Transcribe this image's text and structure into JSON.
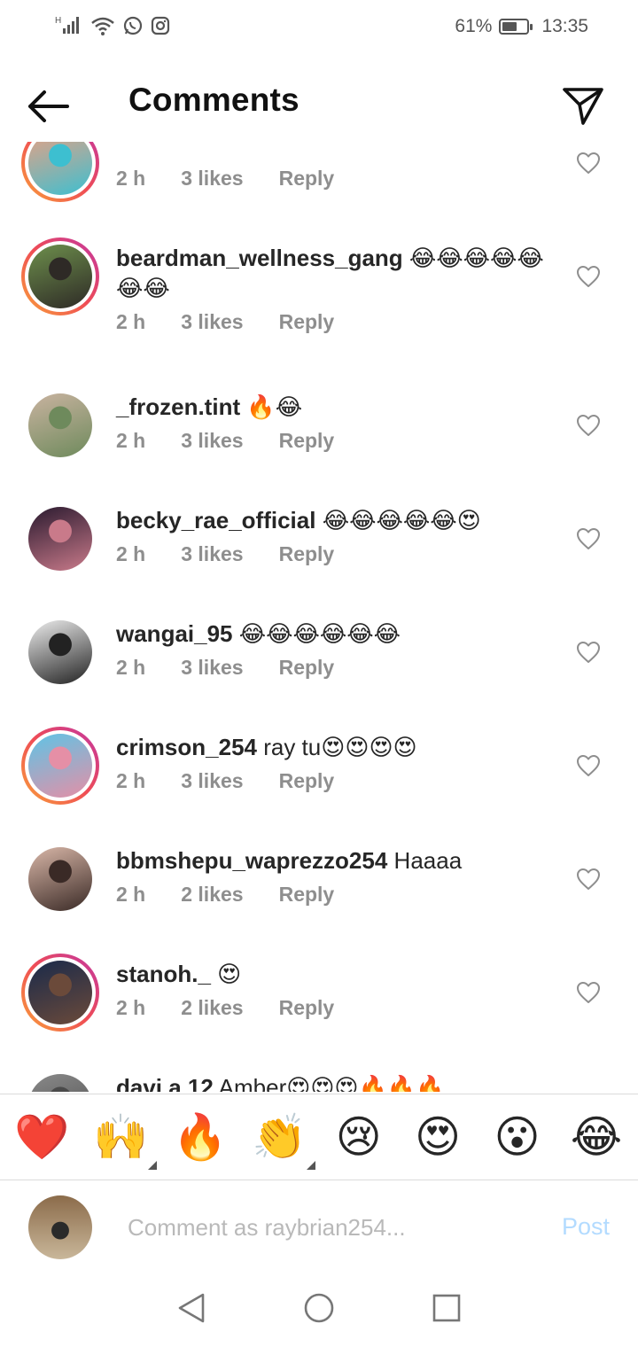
{
  "status_bar": {
    "battery_text": "61%",
    "battery_level": 0.61,
    "time": "13:35"
  },
  "header": {
    "title": "Comments"
  },
  "comments": [
    {
      "username": "",
      "text": "",
      "time": "2 h",
      "likes": "3 likes",
      "reply": "Reply",
      "ring": "story",
      "avatar_colors": [
        "#e8a184",
        "#3dbfd0"
      ]
    },
    {
      "username": "beardman_wellness_gang",
      "text": " 😂😂😂😂😂😂😂",
      "time": "2 h",
      "likes": "3 likes",
      "reply": "Reply",
      "ring": "story",
      "avatar_colors": [
        "#6d8f4c",
        "#2e2a26"
      ]
    },
    {
      "username": "_frozen.tint",
      "text": " 🔥😂",
      "time": "2 h",
      "likes": "3 likes",
      "reply": "Reply",
      "ring": "plain",
      "avatar_colors": [
        "#c9b3a0",
        "#6e8a5c"
      ]
    },
    {
      "username": "becky_rae_official",
      "text": " 😂😂😂😂😂😍",
      "time": "2 h",
      "likes": "3 likes",
      "reply": "Reply",
      "ring": "plain",
      "avatar_colors": [
        "#2a1a2f",
        "#c97a8a"
      ]
    },
    {
      "username": "wangai_95",
      "text": " 😂😂😂😂😂😂",
      "time": "2 h",
      "likes": "3 likes",
      "reply": "Reply",
      "ring": "plain",
      "avatar_colors": [
        "#ededed",
        "#222222"
      ]
    },
    {
      "username": "crimson_254",
      "text": " ray tu😍😍😍😍",
      "time": "2 h",
      "likes": "3 likes",
      "reply": "Reply",
      "ring": "story",
      "avatar_colors": [
        "#5ec4e6",
        "#e58fa6"
      ]
    },
    {
      "username": "bbmshepu_waprezzo254",
      "text": " Haaaa",
      "time": "2 h",
      "likes": "2 likes",
      "reply": "Reply",
      "ring": "plain",
      "avatar_colors": [
        "#d9b7a8",
        "#3a2a26"
      ]
    },
    {
      "username": "stanoh._",
      "text": " 😍",
      "time": "2 h",
      "likes": "2 likes",
      "reply": "Reply",
      "ring": "story",
      "avatar_colors": [
        "#1a2a4a",
        "#6b4a3a"
      ]
    },
    {
      "username": "davi.a.12",
      "text": " Amber😍😍😍🔥🔥🔥",
      "time": "",
      "likes": "",
      "reply": "",
      "ring": "plain",
      "avatar_colors": [
        "#8a8a8a",
        "#4a4a4a"
      ]
    }
  ],
  "quick_reactions": [
    {
      "emoji": "❤️",
      "name": "heart-emoji",
      "skin_tone": false
    },
    {
      "emoji": "🙌",
      "name": "raising-hands-emoji",
      "skin_tone": true
    },
    {
      "emoji": "🔥",
      "name": "fire-emoji",
      "skin_tone": false
    },
    {
      "emoji": "👏",
      "name": "clapping-hands-emoji",
      "skin_tone": true
    },
    {
      "emoji": "😢",
      "name": "crying-face-emoji",
      "skin_tone": false
    },
    {
      "emoji": "😍",
      "name": "heart-eyes-emoji",
      "skin_tone": false
    },
    {
      "emoji": "😮",
      "name": "surprised-face-emoji",
      "skin_tone": false
    },
    {
      "emoji": "😂",
      "name": "tears-of-joy-emoji",
      "skin_tone": false
    }
  ],
  "composer": {
    "placeholder": "Comment as raybrian254...",
    "post_label": "Post",
    "avatar_colors": [
      "#8b6b4a",
      "#2a2a2a"
    ]
  },
  "colors": {
    "text_primary": "#262626",
    "text_secondary": "#8e8e8e",
    "post_disabled": "#b3dbff",
    "story_ring_start": "#f9a23a",
    "story_ring_end": "#c236a3"
  }
}
